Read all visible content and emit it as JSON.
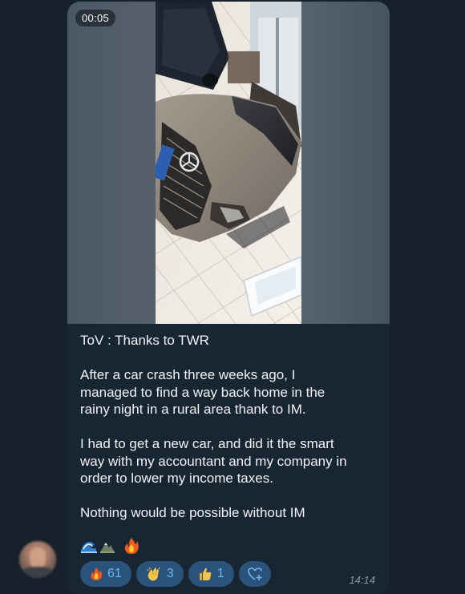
{
  "video": {
    "duration": "00:05"
  },
  "caption": {
    "line1": "ToV : Thanks to TWR",
    "line2a": "After a car crash three weeks ago, I",
    "line2b": "managed to find a way back home in the",
    "line2c": "rainy night in a rural area thank to IM.",
    "line3a": "I had to get a new car, and did it the smart",
    "line3b": "way with my accountant and my company in",
    "line3c": "order to lower my income taxes.",
    "line4": "Nothing would be possible without IM"
  },
  "emoji_line": [
    "wave-emoji",
    "mountain-emoji",
    "fire-emoji"
  ],
  "reactions": [
    {
      "icon": "fire-icon",
      "count": "61"
    },
    {
      "icon": "clapping-hands-icon",
      "count": "3"
    },
    {
      "icon": "thumbs-up-icon",
      "count": "1"
    }
  ],
  "message": {
    "time": "14:14"
  },
  "colors": {
    "background": "#17212b",
    "bubble": "#182533",
    "reaction_pill": "#2b5278",
    "reaction_text": "#6fb6f2",
    "timestamp": "#8a98a6"
  }
}
